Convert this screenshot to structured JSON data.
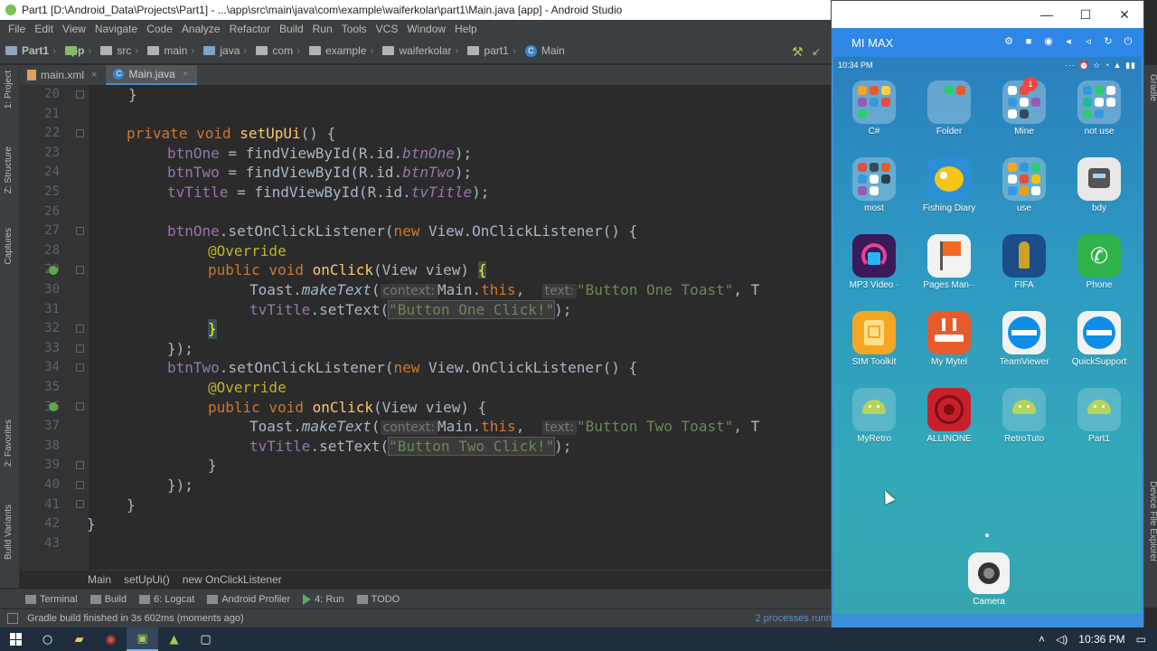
{
  "window": {
    "title": "Part1 [D:\\Android_Data\\Projects\\Part1] - ...\\app\\src\\main\\java\\com\\example\\waiferkolar\\part1\\Main.java [app] - Android Studio"
  },
  "menu": [
    "File",
    "Edit",
    "View",
    "Navigate",
    "Code",
    "Analyze",
    "Refactor",
    "Build",
    "Run",
    "Tools",
    "VCS",
    "Window",
    "Help"
  ],
  "breadcrumbs": [
    "Part1",
    "app",
    "src",
    "main",
    "java",
    "com",
    "example",
    "waiferkolar",
    "part1",
    "Main"
  ],
  "tabs": [
    {
      "label": "main.xml"
    },
    {
      "label": "Main.java"
    }
  ],
  "left_tools": [
    "1: Project",
    "Z: Structure",
    "Captures",
    "2: Favorites",
    "Build Variants"
  ],
  "right_tools": [
    "Gradle",
    "Device File Explorer"
  ],
  "editor": {
    "line_numbers": [
      "20",
      "21",
      "22",
      "23",
      "24",
      "25",
      "26",
      "27",
      "28",
      "29",
      "30",
      "31",
      "32",
      "33",
      "34",
      "35",
      "36",
      "37",
      "38",
      "39",
      "40",
      "41",
      "42",
      "43"
    ],
    "l20": "}",
    "l22_kw": "private void",
    "l22_fn": "setUpUi",
    "l22_rest": "() {",
    "l23_f": "btnOne",
    "l23_a": " = findViewById(R.id.",
    "l23_b": "btnOne",
    "l23_c": ");",
    "l24_f": "btnTwo",
    "l24_a": " = findViewById(R.id.",
    "l24_b": "btnTwo",
    "l24_c": ");",
    "l25_f": "tvTitle",
    "l25_a": " = findViewById(R.id.",
    "l25_b": "tvTitle",
    "l25_c": ");",
    "l27_f": "btnOne",
    "l27_a": ".setOnClickListener(",
    "l27_kw": "new",
    "l27_b": " View.OnClickListener() {",
    "l28": "@Override",
    "l29_kw": "public void",
    "l29_fn": "onClick",
    "l29_a": "(View view) ",
    "l29_br": "{",
    "l30_a": "Toast.",
    "l30_b": "makeText",
    "l30_c": "(",
    "l30_h1": "context:",
    "l30_d": "Main.",
    "l30_kw": "this",
    "l30_e": ",  ",
    "l30_h2": "text:",
    "l30_s": "\"Button One Toast\"",
    "l30_f": ", T",
    "l31_f": "tvTitle",
    "l31_a": ".setText(",
    "l31_s": "\"Button One Click!\"",
    "l31_c": ");",
    "l32": "}",
    "l33": "});",
    "l34_f": "btnTwo",
    "l34_a": ".setOnClickListener(",
    "l34_kw": "new",
    "l34_b": " View.OnClickListener() {",
    "l35": "@Override",
    "l36_kw": "public void",
    "l36_fn": "onClick",
    "l36_a": "(View view) {",
    "l37_a": "Toast.",
    "l37_b": "makeText",
    "l37_c": "(",
    "l37_h1": "context:",
    "l37_d": "Main.",
    "l37_kw": "this",
    "l37_e": ",  ",
    "l37_h2": "text:",
    "l37_s": "\"Button Two Toast\"",
    "l37_f": ", T",
    "l38_f": "tvTitle",
    "l38_a": ".setText(",
    "l38_s": "\"Button Two Click!\"",
    "l38_c": ");",
    "l39": "}",
    "l40": "});",
    "l41": "}",
    "l42": "}"
  },
  "editor_breadcrumb": [
    "Main",
    "setUpUi()",
    "new OnClickListener"
  ],
  "bottom_tools": [
    "Terminal",
    "Build",
    "6: Logcat",
    "Android Profiler",
    "4: Run",
    "TODO"
  ],
  "status": {
    "message": "Gradle build finished in 3s 602ms (moments ago)",
    "processes": "2 processes runn"
  },
  "emulator": {
    "device_name": "MI MAX",
    "phone_time": "10:34 PM",
    "apps": [
      {
        "label": "C#",
        "color": "#5a7fa6"
      },
      {
        "label": "Folder",
        "color": "#4f86b5"
      },
      {
        "label": "Mine",
        "color": "#5a8fbd",
        "badge": "1"
      },
      {
        "label": "not use",
        "color": "#4f86b5"
      },
      {
        "label": "most",
        "color": "#5a7fa6"
      },
      {
        "label": "Fishing Diary",
        "color": "#2a8fd4"
      },
      {
        "label": "use",
        "color": "#5a8fbd"
      },
      {
        "label": "bdy",
        "color": "#e8e8e8"
      },
      {
        "label": "MP3 Video ·",
        "color": "#6a2a9a"
      },
      {
        "label": "Pages Man··",
        "color": "#f2f2f2"
      },
      {
        "label": "FIFA",
        "color": "#1a4d8a"
      },
      {
        "label": "Phone",
        "color": "#2fb24a"
      },
      {
        "label": "SIM Toolkit",
        "color": "#f5a623"
      },
      {
        "label": "My Mytel",
        "color": "#e85a2a"
      },
      {
        "label": "TeamViewer",
        "color": "#f2f2f2"
      },
      {
        "label": "QuickSupport",
        "color": "#f2f2f2"
      },
      {
        "label": "MyRetro",
        "color": "#ffffff33"
      },
      {
        "label": "ALLINONE",
        "color": "#c8202a"
      },
      {
        "label": "RetroTuto",
        "color": "#ffffff33"
      },
      {
        "label": "Part1",
        "color": "#ffffff33"
      }
    ],
    "dock_app": "Camera"
  },
  "taskbar": {
    "time": "10:36 PM"
  }
}
